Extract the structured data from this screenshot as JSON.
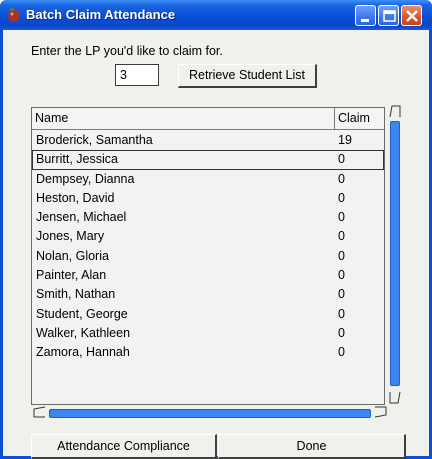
{
  "window": {
    "title": "Batch Claim Attendance",
    "title_bar_color": "#0b4fd6",
    "controls": [
      "minimize-icon",
      "maximize-icon",
      "close-icon"
    ]
  },
  "form": {
    "prompt": "Enter the LP you'd like to claim for.",
    "lp_value": "3",
    "retrieve_label": "Retrieve Student List"
  },
  "table": {
    "columns": [
      "Name",
      "Claim"
    ],
    "selected_index": 1,
    "rows": [
      {
        "name": "Broderick, Samantha",
        "claim": "19"
      },
      {
        "name": "Burritt, Jessica",
        "claim": "0"
      },
      {
        "name": "Dempsey, Dianna",
        "claim": "0"
      },
      {
        "name": "Heston, David",
        "claim": "0"
      },
      {
        "name": "Jensen, Michael",
        "claim": "0"
      },
      {
        "name": "Jones, Mary",
        "claim": "0"
      },
      {
        "name": "Nolan, Gloria",
        "claim": "0"
      },
      {
        "name": "Painter, Alan",
        "claim": "0"
      },
      {
        "name": "Smith, Nathan",
        "claim": "0"
      },
      {
        "name": "Student, George",
        "claim": "0"
      },
      {
        "name": "Walker, Kathleen",
        "claim": "0"
      },
      {
        "name": "Zamora, Hannah",
        "claim": "0"
      }
    ]
  },
  "buttons": {
    "compliance_label": "Attendance Compliance",
    "done_label": "Done"
  },
  "colors": {
    "accent": "#3d86f2",
    "window_bg": "#f0f0ec"
  }
}
